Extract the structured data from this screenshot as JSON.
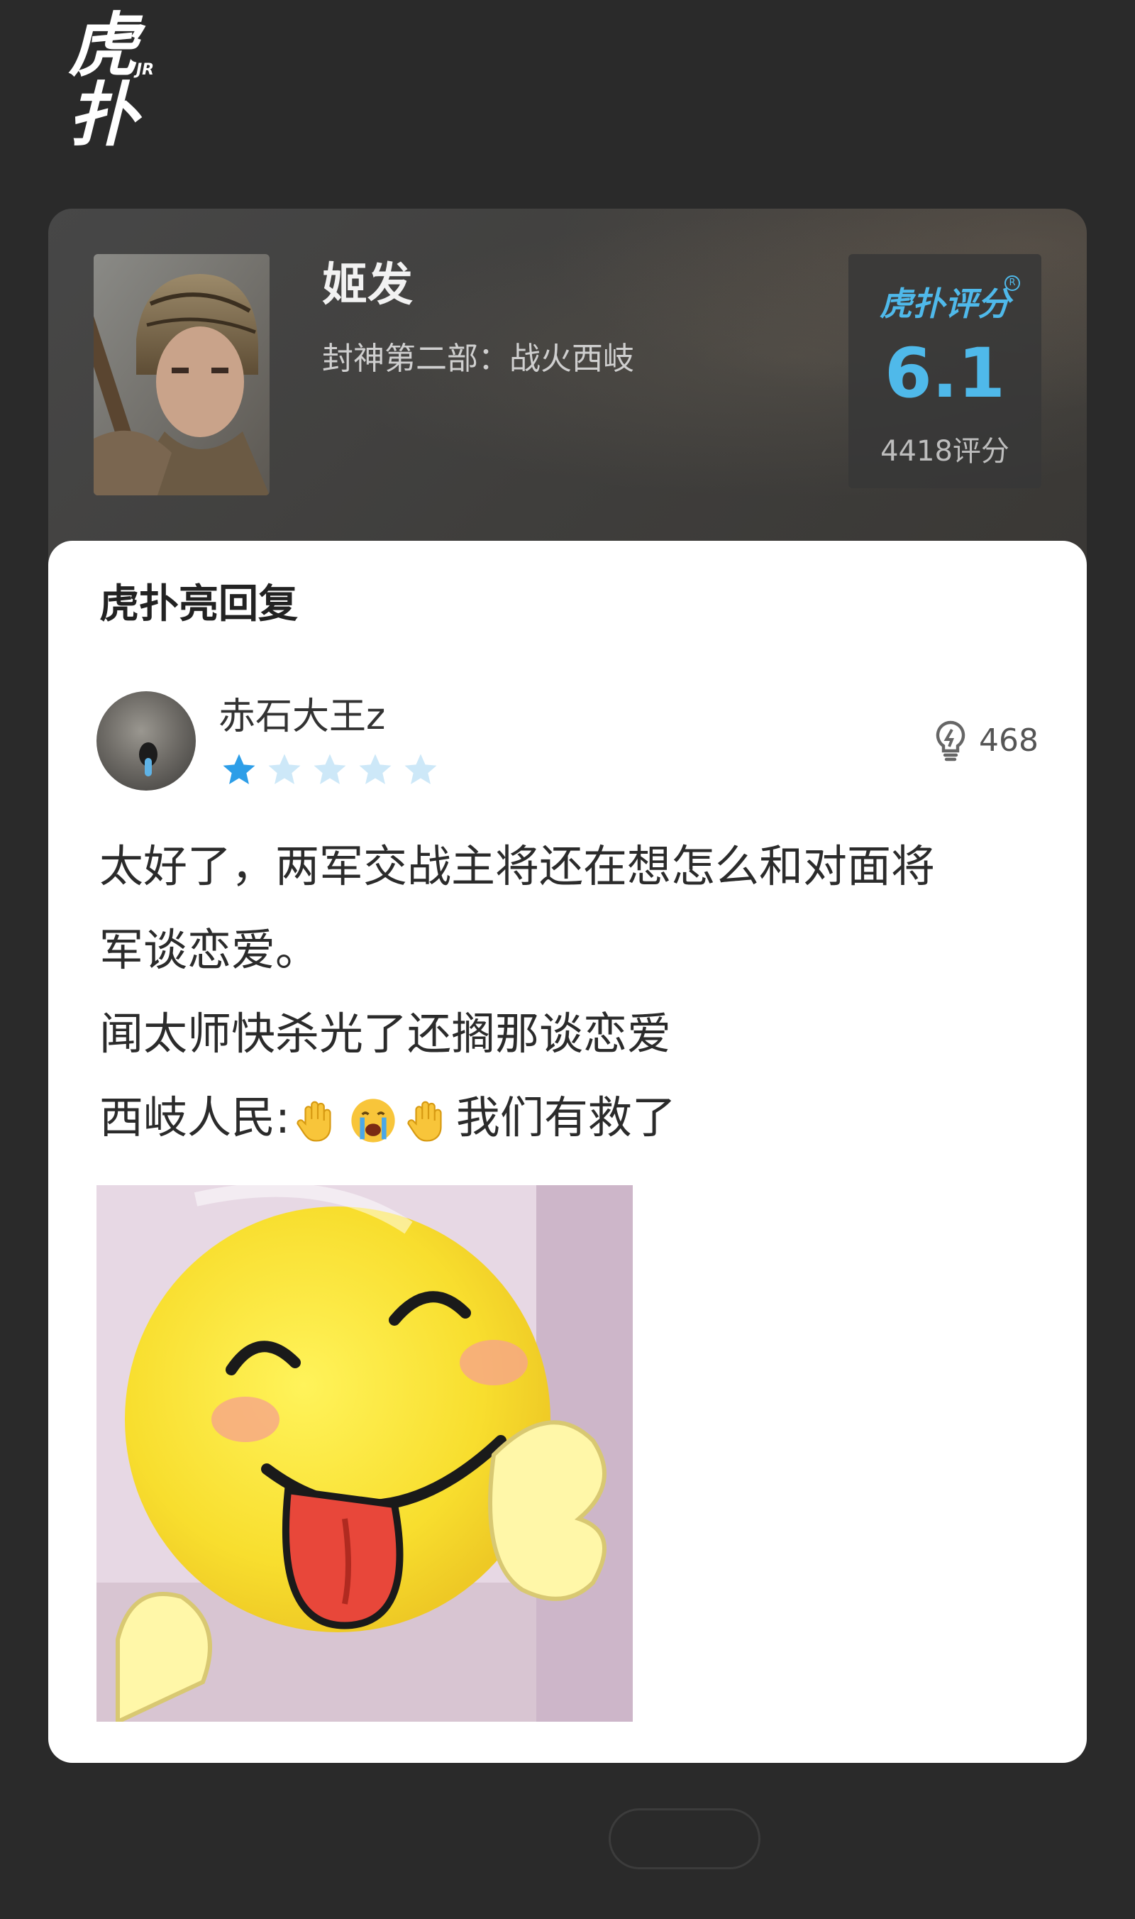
{
  "app": {
    "logo_text": "虎扑",
    "logo_sup": "JR"
  },
  "movie": {
    "character": "姬发",
    "film": "封神第二部：战火西岐",
    "score_brand": "虎扑评分",
    "score_reg": "R",
    "score": "6.1",
    "rating_count": "4418评分"
  },
  "reply": {
    "heading": "虎扑亮回复",
    "username": "赤石大王z",
    "star_rating": 1,
    "star_total": 5,
    "likes": "468",
    "line1": "太好了，两军交战主将还在想怎么和对面将",
    "line2": "军谈恋爱。",
    "line3": "闻太师快杀光了还搁那谈恋爱",
    "line4_prefix": "西岐人民:",
    "line4_suffix": "我们有救了",
    "line4_emojis": [
      "raised-hand-emoji",
      "crying-face-emoji",
      "raised-hand-emoji"
    ]
  },
  "colors": {
    "background": "#2a2a2a",
    "accent_blue": "#4fb9ea",
    "star_filled": "#2d9ee8",
    "star_empty": "#cde8f8"
  }
}
